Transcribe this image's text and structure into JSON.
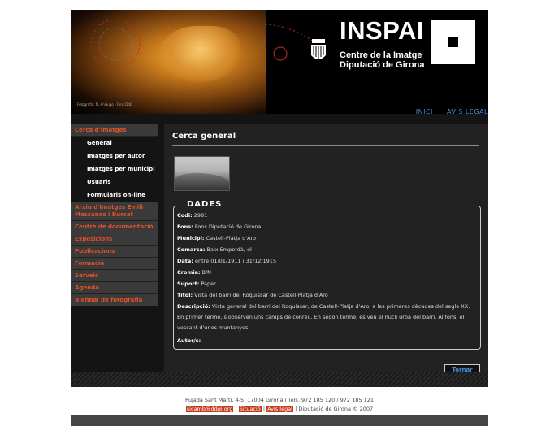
{
  "header": {
    "photo_credit": "Fotografia: N. Anlaugo - Fons DdG",
    "brand_name": "INSPAI",
    "brand_sub1": "Centre de la Imatge",
    "brand_sub2": "Diputació de Girona"
  },
  "topnav": {
    "inici": "INICI",
    "avis_legal": "AVÍS LEGAL"
  },
  "sidebar": {
    "cerca": "Cerca d'imatges",
    "sub": [
      "General",
      "Imatges per autor",
      "Imatges per municipi",
      "Usuaris",
      "Formularis on-line"
    ],
    "arxiu": "Arxiu d'Imatges Emili Massanas i Burcet",
    "items": [
      "Centre de documentació",
      "Exposicions",
      "Publicacions",
      "Formació",
      "Serveis",
      "Agenda",
      "Biennal de fotografia"
    ]
  },
  "content": {
    "title": "Cerca general",
    "legend": "DADES",
    "codi_label": "Codi:",
    "codi": "2981",
    "fons_label": "Fons:",
    "fons": "Fons Diputació de Girona",
    "municipi_label": "Municipi:",
    "municipi": "Castell-Platja d'Aro",
    "comarca_label": "Comarca:",
    "comarca": "Baix Empordà, el",
    "data_label": "Data:",
    "data": "entre 01/01/1911 i 31/12/1915",
    "cromia_label": "Cromia:",
    "cromia": "B/N",
    "suport_label": "Suport:",
    "suport": "Paper",
    "titol_label": "Títol:",
    "titol": "Vista del barri del Roquissar de Castell-Platja d'Aro",
    "descripcio_label": "Descripció:",
    "descripcio": "Vista general del barri del Roquissar, de Castell-Platja d'Aro, a les primeres dècades del segle XX. En primer terme, s'observen uns camps de conreu. En segon terme, es veu el nucli urbà del barri. Al fons, el vessant d'unes muntanyes.",
    "autor_label": "Autor/s:",
    "button": "Tornar"
  },
  "footer": {
    "address": "Pujada Sant Martí, 4-5. 17004 Girona | Tels. 972 185 120 / 972 185 121",
    "email": "sicamb@ddgi.org",
    "situacio": "Situació",
    "avis": "Avís legal",
    "copyright": "Diputació de Girona © 2007"
  }
}
